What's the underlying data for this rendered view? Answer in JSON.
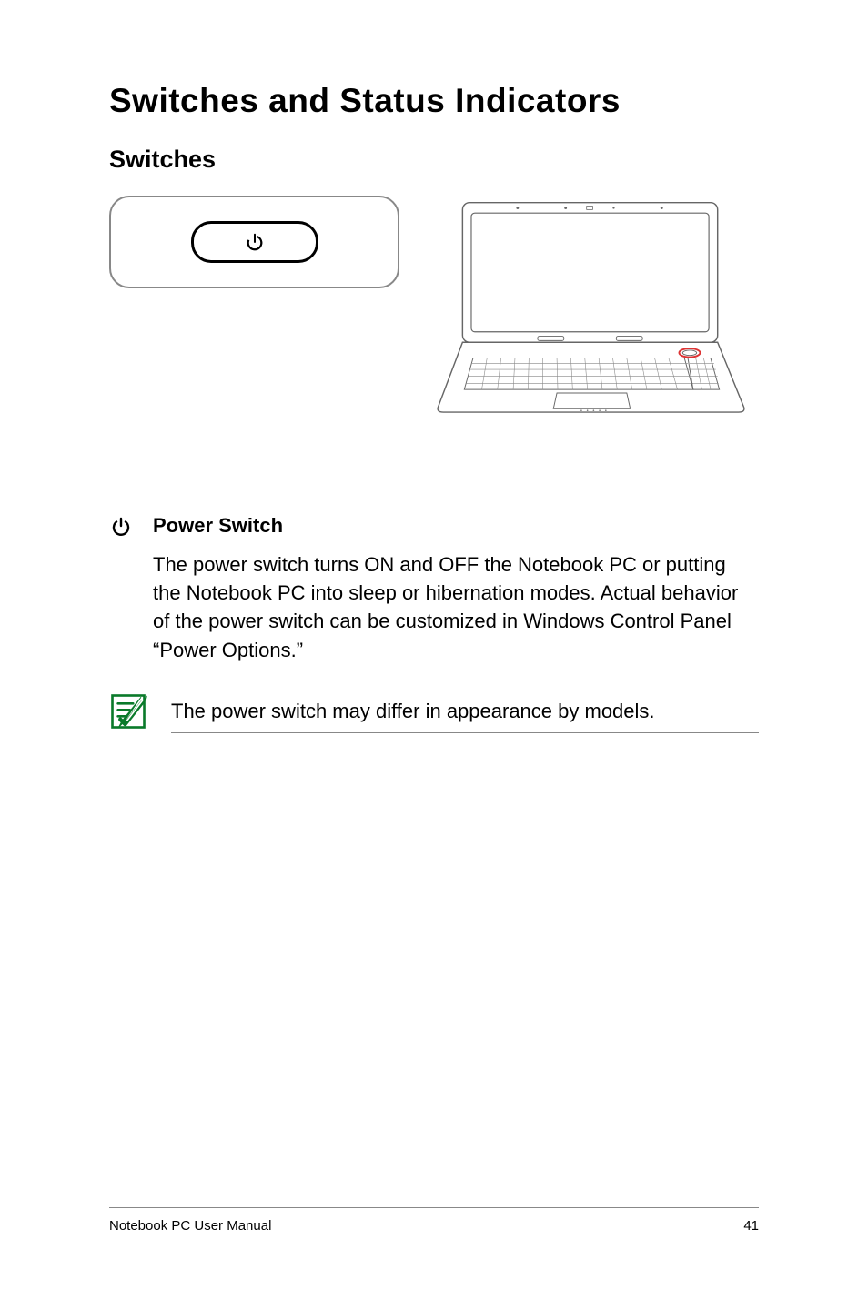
{
  "page": {
    "title": "Switches and Status Indicators",
    "section_heading": "Switches",
    "subsection": {
      "title": "Power Switch",
      "body": "The power switch turns ON and OFF the Notebook PC or putting the Notebook PC into sleep or hibernation modes. Actual behavior of the power switch can be customized in Windows Control Panel “Power Options.”"
    },
    "note": "The power switch may differ in appearance by models.",
    "footer_left": "Notebook PC User Manual",
    "footer_right": "41"
  }
}
